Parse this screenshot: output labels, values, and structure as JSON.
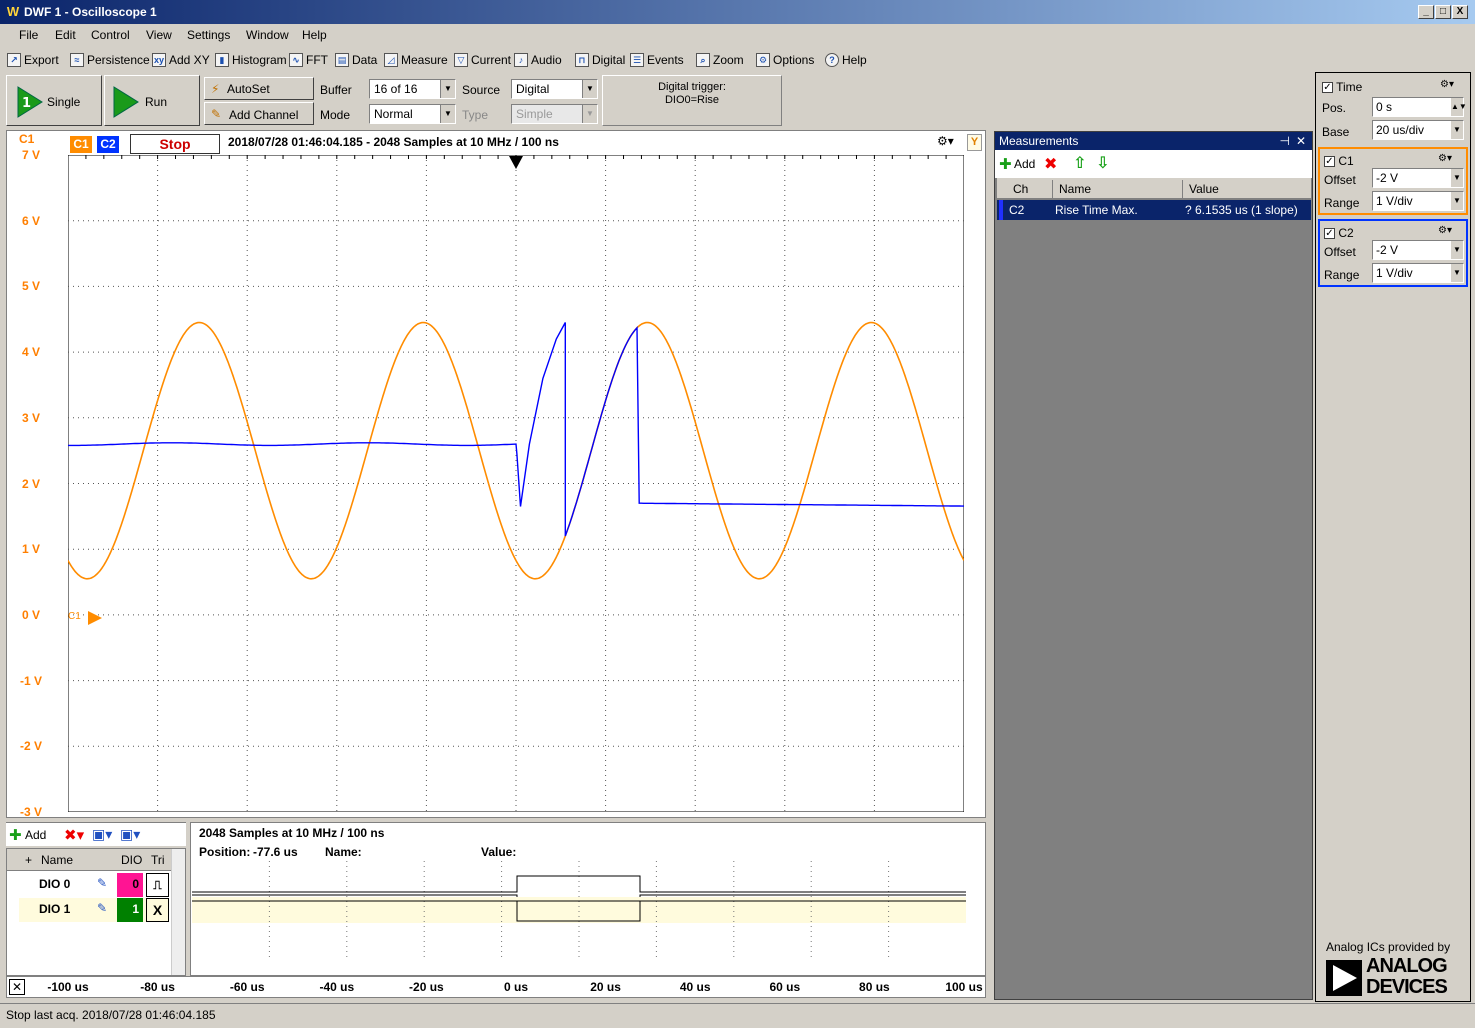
{
  "window": {
    "title": "DWF 1 - Oscilloscope 1",
    "min": "_",
    "max": "□",
    "close": "X"
  },
  "menu": [
    "File",
    "Edit",
    "Control",
    "View",
    "Settings",
    "Window",
    "Help"
  ],
  "toolbar": [
    {
      "label": "Export",
      "icon": "export-icon"
    },
    {
      "label": "Persistence",
      "icon": "persistence-icon"
    },
    {
      "label": "Add XY",
      "icon": "add-xy-icon"
    },
    {
      "label": "Histogram",
      "icon": "histogram-icon"
    },
    {
      "label": "FFT",
      "icon": "fft-icon"
    },
    {
      "label": "Data",
      "icon": "data-icon"
    },
    {
      "label": "Measure",
      "icon": "measure-icon"
    },
    {
      "label": "Current",
      "icon": "current-icon"
    },
    {
      "label": "Audio",
      "icon": "audio-icon"
    },
    {
      "label": "Digital",
      "icon": "digital-icon"
    },
    {
      "label": "Events",
      "icon": "events-icon"
    },
    {
      "label": "Zoom",
      "icon": "zoom-icon"
    },
    {
      "label": "Options",
      "icon": "options-icon"
    },
    {
      "label": "Help",
      "icon": "help-icon"
    }
  ],
  "controls": {
    "single": "Single",
    "run": "Run",
    "autoset": "AutoSet",
    "add_channel": "Add Channel",
    "buffer_label": "Buffer",
    "buffer_value": "16 of 16",
    "mode_label": "Mode",
    "mode_value": "Normal",
    "source_label": "Source",
    "source_value": "Digital",
    "type_label": "Type",
    "type_value": "Simple",
    "trigger_line1": "Digital trigger:",
    "trigger_line2": "DIO0=Rise"
  },
  "scope": {
    "c1_corner": "C1",
    "c1_badge": "C1",
    "c2_badge": "C2",
    "state": "Stop",
    "info": "2018/07/28 01:46:04.185 - 2048 Samples at 10 MHz / 100 ns",
    "y_icon": "Y",
    "c1_marker": "C1",
    "y_ticks": [
      "7 V",
      "6 V",
      "5 V",
      "4 V",
      "3 V",
      "2 V",
      "1 V",
      "0 V",
      "-1 V",
      "-2 V",
      "-3 V"
    ],
    "colors": {
      "c1": "#ff8c00",
      "c2": "#0000ff"
    }
  },
  "measurements": {
    "title": "Measurements",
    "add": "Add",
    "cols": [
      "Ch",
      "Name",
      "Value"
    ],
    "rows": [
      {
        "ch": "C2",
        "name": "Rise Time Max.",
        "value": "? 6.1535 us (1 slope)"
      }
    ]
  },
  "time_settings": {
    "title": "Time",
    "pos_label": "Pos.",
    "pos_value": "0 s",
    "base_label": "Base",
    "base_value": "20 us/div"
  },
  "c1_settings": {
    "title": "C1",
    "offset_label": "Offset",
    "offset_value": "-2 V",
    "range_label": "Range",
    "range_value": "1 V/div"
  },
  "c2_settings": {
    "title": "C2",
    "offset_label": "Offset",
    "offset_value": "-2 V",
    "range_label": "Range",
    "range_value": "1 V/div"
  },
  "digital": {
    "add": "Add",
    "cols": [
      "+",
      "Name",
      "DIO",
      "Tri"
    ],
    "channels": [
      {
        "name": "DIO 0",
        "dio": "0",
        "trig": "rise"
      },
      {
        "name": "DIO 1",
        "dio": "1",
        "trig": "X"
      }
    ],
    "info": "2048 Samples at 10 MHz / 100 ns",
    "position_label": "Position:",
    "position_value": "-77.6 us",
    "name_label": "Name:",
    "value_label": "Value:"
  },
  "time_ticks": [
    "-100 us",
    "-80 us",
    "-60 us",
    "-40 us",
    "-20 us",
    "0 us",
    "20 us",
    "40 us",
    "60 us",
    "80 us",
    "100 us"
  ],
  "status": "Stop last acq. 2018/07/28  01:46:04.185",
  "brand": {
    "caption": "Analog ICs provided by",
    "line1": "ANALOG",
    "line2": "DEVICES"
  }
}
